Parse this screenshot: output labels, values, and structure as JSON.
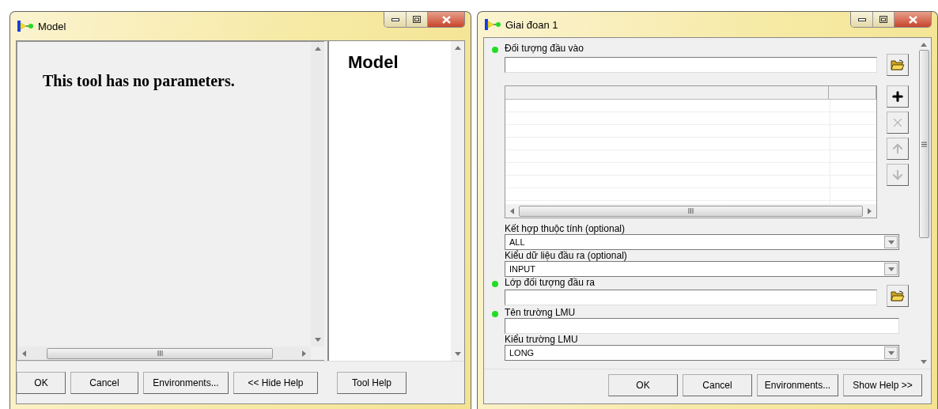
{
  "left_window": {
    "title": "Model",
    "message": "This tool has no parameters.",
    "help_title": "Model",
    "buttons": [
      "OK",
      "Cancel",
      "Environments...",
      "<< Hide Help",
      "Tool Help"
    ]
  },
  "right_window": {
    "title": "Giai đoan 1",
    "parameters": [
      {
        "kind": "file-list",
        "label": "Đối tượng đầu vào",
        "required": true
      },
      {
        "kind": "dropdown",
        "label": "Kết hợp thuộc tính (optional)",
        "value": "ALL",
        "required": false
      },
      {
        "kind": "dropdown",
        "label": "Kiểu dữ liệu đầu ra (optional)",
        "value": "INPUT",
        "required": false
      },
      {
        "kind": "file",
        "label": "Lớp đối tượng đầu ra",
        "required": true
      },
      {
        "kind": "text",
        "label": "Tên trường LMU",
        "required": true
      },
      {
        "kind": "dropdown",
        "label": "Kiểu trường LMU",
        "value": "LONG",
        "required": false
      }
    ],
    "list_buttons": [
      {
        "kind": "add",
        "disabled": false
      },
      {
        "kind": "remove",
        "disabled": true
      },
      {
        "kind": "up",
        "disabled": true
      },
      {
        "kind": "down",
        "disabled": true
      }
    ],
    "buttons": [
      "OK",
      "Cancel",
      "Environments...",
      "Show Help >>"
    ]
  }
}
